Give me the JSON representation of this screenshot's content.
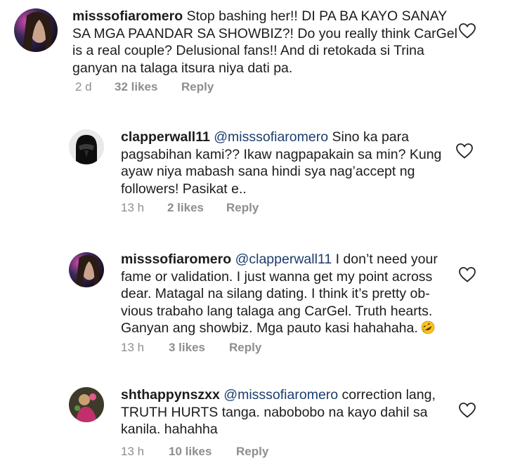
{
  "comments": [
    {
      "username": "misssofiaromero",
      "mention": "",
      "text_lines": [
        " Stop bashing her!! DI PA BA KAYO SANAY",
        "SA MGA PAANDAR SA SHOWBIZ?! Do you really think CarGel",
        "is a real couple? Delusional fans!! And di retokada si Trina",
        "ganyan na talaga itsura niya dati pa."
      ],
      "time": "2 d",
      "likes": "32 likes",
      "reply": "Reply",
      "avatar_icon": "woman-portrait-avatar"
    },
    {
      "username": "clapperwall11",
      "mention": "@misssofiaromero",
      "text_lines": [
        " Sino ka para",
        "pagsabihan kami?? Ikaw nagpapakain sa min? Kung",
        "ayaw niya mabash sana hindi sya nag’accept ng",
        "followers! Pasikat e.."
      ],
      "time": "13 h",
      "likes": "2 likes",
      "reply": "Reply",
      "avatar_icon": "dark-helmet-avatar"
    },
    {
      "username": "misssofiaromero",
      "mention": "@clapperwall11",
      "text_lines": [
        " I don’t need your",
        "fame or validation. I just wanna get my point across",
        "dear. Matagal na silang dating. I think it’s pretty ob-",
        "vious trabaho lang talaga ang CarGel. Truth hearts.",
        "Ganyan ang showbiz. Mga pauto kasi hahahaha."
      ],
      "time": "13 h",
      "likes": "3 likes",
      "reply": "Reply",
      "avatar_icon": "woman-portrait-avatar",
      "emoji": "rolling-laughing-emoji-icon"
    },
    {
      "username": "shthappynszxx",
      "mention": "@misssofiaromero",
      "text_lines": [
        " correction lang,",
        "TRUTH HURTS tanga. nabobobo na kayo dahil sa",
        "kanila. hahahha"
      ],
      "time": "13 h",
      "likes": "10 likes",
      "reply": "Reply",
      "avatar_icon": "colorful-figure-avatar"
    }
  ],
  "colors": {
    "text": "#1c1c1c",
    "meta": "#8e8e8e",
    "mention": "#1c3d6e"
  }
}
